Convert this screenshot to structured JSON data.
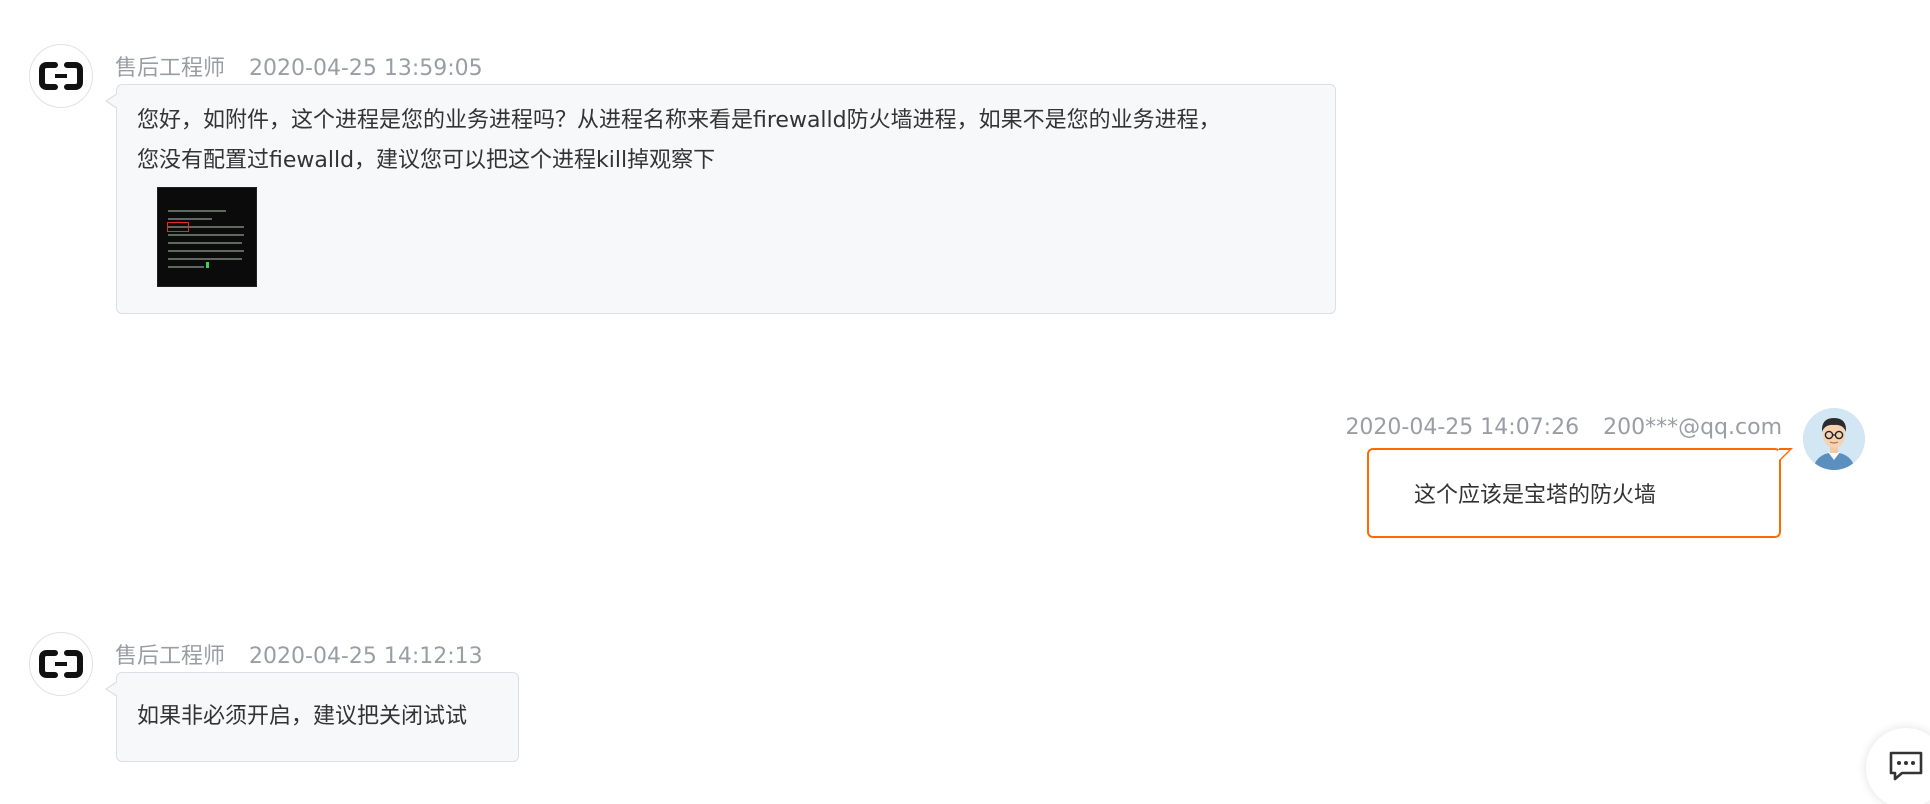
{
  "messages": [
    {
      "role": "engineer",
      "sender": "售后工程师",
      "time": "2020-04-25 13:59:05",
      "text_line1": "您好，如附件，这个进程是您的业务进程吗？从进程名称来看是firewalld防火墙进程，如果不是您的业务进程，",
      "text_line2": "您没有配置过fiewalld，建议您可以把这个进程kill掉观察下",
      "has_attachment": true
    },
    {
      "role": "user",
      "sender": "200***@qq.com",
      "time": "2020-04-25 14:07:26",
      "text": "这个应该是宝塔的防火墙"
    },
    {
      "role": "engineer",
      "sender": "售后工程师",
      "time": "2020-04-25 14:12:13",
      "text": "如果非必须开启，建议把关闭试试"
    }
  ],
  "colors": {
    "accent_orange": "#ff6a00",
    "meta_gray": "#9a9ea4",
    "bubble_bg": "#f7f8fa",
    "bubble_border": "#dcdfe4",
    "text": "#333333"
  },
  "icons": {
    "engineer_avatar": "aliyun-logo-icon",
    "user_avatar": "user-avatar-icon",
    "chat_button": "chat-bubble-icon"
  }
}
